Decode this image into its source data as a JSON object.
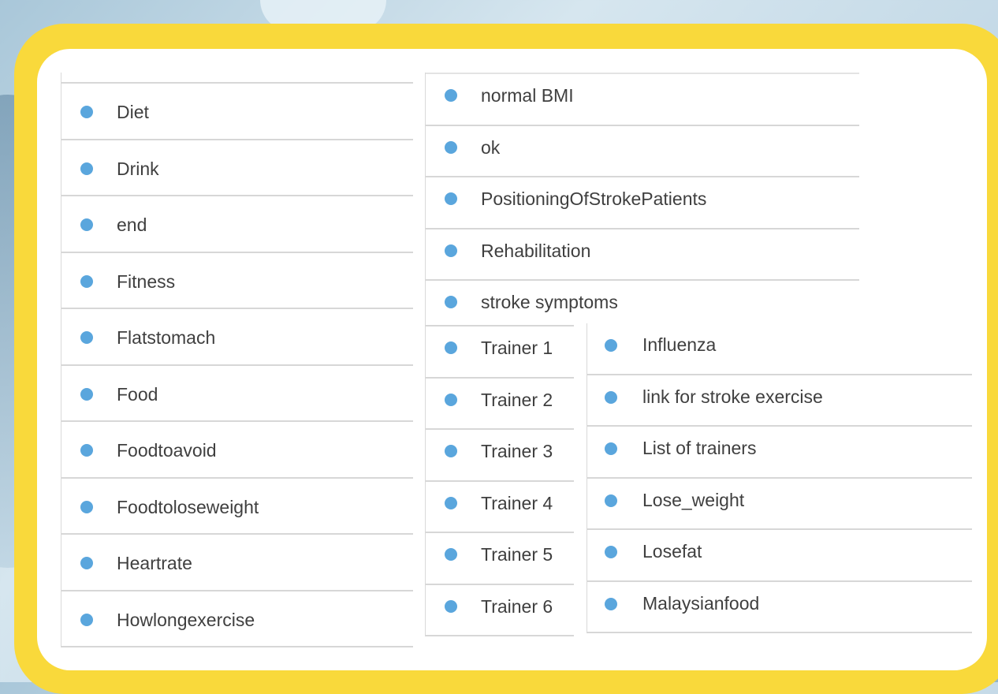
{
  "colors": {
    "frame": "#f9d93b",
    "bullet": "#5aa6dd",
    "divider": "#d7d7d7",
    "text": "#3f3f3f"
  },
  "icons": {
    "bullet": "bullet-dot-icon"
  },
  "lists": {
    "col_a": [
      "Diet",
      "Drink",
      "end",
      "Fitness",
      "Flatstomach",
      "Food",
      "Foodtoavoid",
      "Foodtoloseweight",
      "Heartrate",
      "Howlongexercise"
    ],
    "col_b": [
      "normal BMI",
      "ok",
      "PositioningOfStrokePatients",
      "Rehabilitation",
      "stroke symptoms"
    ],
    "col_c": [
      "Trainer 1",
      "Trainer 2",
      "Trainer 3",
      "Trainer 4",
      "Trainer 5",
      "Trainer 6"
    ],
    "col_d": [
      "Influenza",
      "link for stroke exercise",
      "List of trainers",
      "Lose_weight",
      "Losefat",
      "Malaysianfood"
    ]
  }
}
